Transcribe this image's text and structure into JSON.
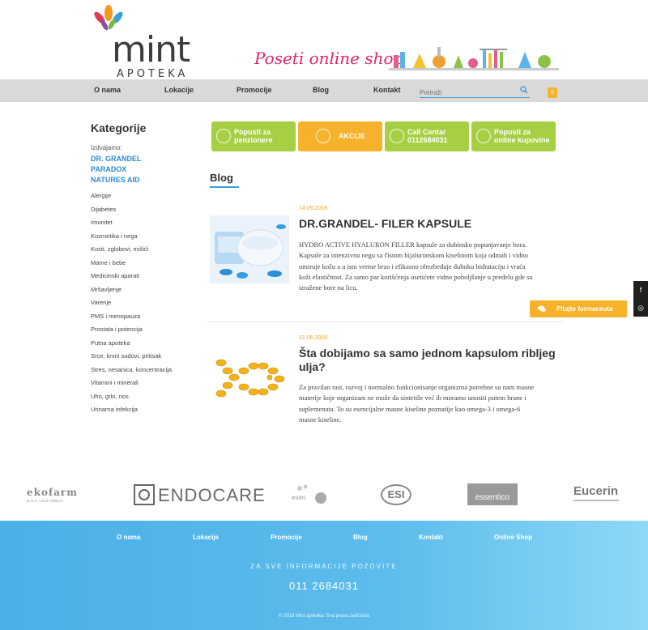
{
  "header": {
    "logo_word": "mint",
    "logo_sub": "APOTEKA",
    "banner_text": "Poseti online shop"
  },
  "nav": {
    "items": [
      "O nama",
      "Lokacije",
      "Promocije",
      "Blog",
      "Kontakt"
    ],
    "search_placeholder": "Pretraži",
    "cart_count": "0"
  },
  "sidebar": {
    "title": "Kategorije",
    "featured_label": "Izdvajamo:",
    "featured": [
      "DR. GRANDEL",
      "PARADOX",
      "NATURES AID"
    ],
    "categories": [
      "Alergije",
      "Dijabetes",
      "Imunitet",
      "Kozmetika i nega",
      "Kosti, zglobovi, mišići",
      "Mame i bebe",
      "Medicinski aparati",
      "Mršavljenje",
      "Varenje",
      "PMS i menopauza",
      "Prostata i potencija",
      "Putna apoteka",
      "Srce, krvni sudovi, pritisak",
      "Stres, nesanica, koncentracija",
      "Vitamini i minerali",
      "Uho, grlo, nos",
      "Urinarna infekcija"
    ]
  },
  "promos": [
    {
      "line1": "Popusti za",
      "line2": "penzionere",
      "icon": "percent-icon",
      "color": "#a6cf44"
    },
    {
      "line1": "AKCIJE",
      "line2": "",
      "icon": "tag-icon",
      "color": "#f6b22b"
    },
    {
      "line1": "Call Centar",
      "line2": "0112684031",
      "icon": "phone-icon",
      "color": "#a6cf44"
    },
    {
      "line1": "Popusti za",
      "line2": "online kupovine",
      "icon": "cart-percent-icon",
      "color": "#a6cf44"
    }
  ],
  "blog": {
    "title": "Blog",
    "posts": [
      {
        "date": "14.09.2018",
        "title": "DR.GRANDEL- FILER KAPSULE",
        "lines": [
          " HYDRO ACTIVE HYALURON FILLER kapsule  za dubinsko popunjavanje bora.",
          "Kapsule za intenzivnu negu sa čistom hijaluronskom kiselinom koja odmah i vidno",
          "umiruje kožu a u isto vreme brzo i efikasno obezbeđuje duboku hidrataciju i vraća",
          "koži elastičnost.  Za samo par korišćenja osetićete vidno poboljšanje u predelu gde su",
          "izražene bore na licu."
        ]
      },
      {
        "date": "21.06.2018",
        "title_line1": "Šta dobijamo sa samo jednom kapsulom ribljeg",
        "title_line2": "ulja?",
        "lines": [
          "Za pravilan rast, razvoj i normalno funkcionisanje organizma potrebne su nam masne",
          "materije koje organizam ne može da sintetiše već ih moramo unositi putem hrane i",
          "suplemenata. To su esencijalne masne kiseline poznatije kao omega-3 i omega-6",
          "masne kiseline."
        ]
      }
    ]
  },
  "side_widgets": {
    "social": [
      "f",
      "◎"
    ],
    "ask_label": "Pitajte formaceuta"
  },
  "brands": {
    "ekofarm": "ekofarm",
    "ekofarm_sub": "D.O.O. UŠĆE  SRBIJA",
    "endocare": "ENDOCARE",
    "esential": "esen",
    "esi": "ESI",
    "essentico": "essentico",
    "eucerin": "Eucerin"
  },
  "footer": {
    "links": [
      "O nama",
      "Lokacije",
      "Promocije",
      "Blog",
      "Kontakt",
      "Online Shop"
    ],
    "info": "ZA SVE INFORMACIJE POZOVITE",
    "phone": "011 2684031",
    "copyright": "© 2018 Mint apoteka. Sva prava zadržana"
  },
  "colors": {
    "accent_blue": "#3b9ed8",
    "green": "#a6cf44",
    "orange": "#f6b22b",
    "date_orange": "#f5a623",
    "logo_pink": "#e0246a"
  }
}
